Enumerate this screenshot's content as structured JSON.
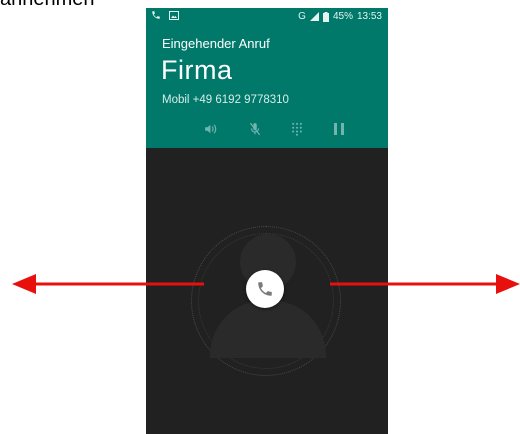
{
  "caption": {
    "text": "annehmen"
  },
  "status_bar": {
    "network": "G",
    "battery": "45%",
    "time": "13:53"
  },
  "call": {
    "title": "Eingehender Anruf",
    "caller": "Firma",
    "number": "Mobil +49 6192 9778310"
  },
  "controls": [
    "speaker-icon",
    "mute-icon",
    "dialpad-icon",
    "pause-icon"
  ],
  "colors": {
    "header": "#00796b",
    "background": "#212121",
    "arrow": "#e8100c"
  }
}
